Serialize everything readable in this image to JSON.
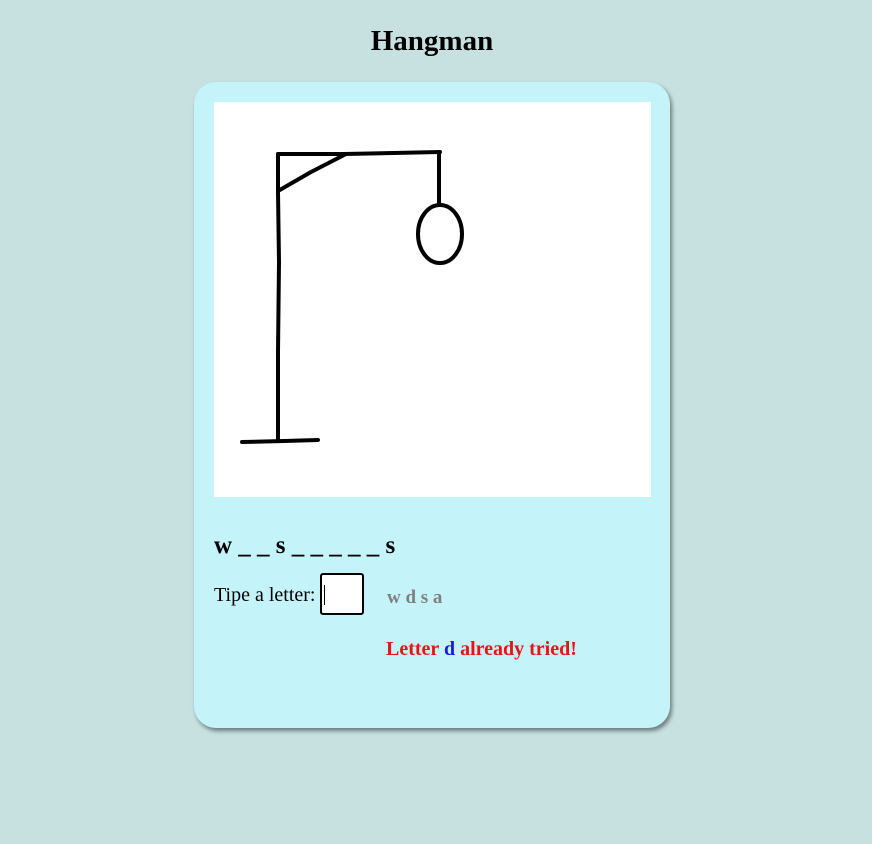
{
  "title": "Hangman",
  "drawing": {
    "stage": "gallows-and-head",
    "stroke_color": "#000000"
  },
  "word_display": "w _ _ s _ _ _ _ _ s",
  "input": {
    "label": "Tipe a letter:",
    "value": ""
  },
  "tried_letters": "w d s a",
  "message": {
    "prefix": "Letter",
    "letter": "d",
    "suffix": "already tried!"
  },
  "colors": {
    "background": "#c6e1e0",
    "card": "#c4f3fa",
    "message": "#ee1111",
    "message_letter": "#1a1ae0",
    "tried": "#808080"
  }
}
